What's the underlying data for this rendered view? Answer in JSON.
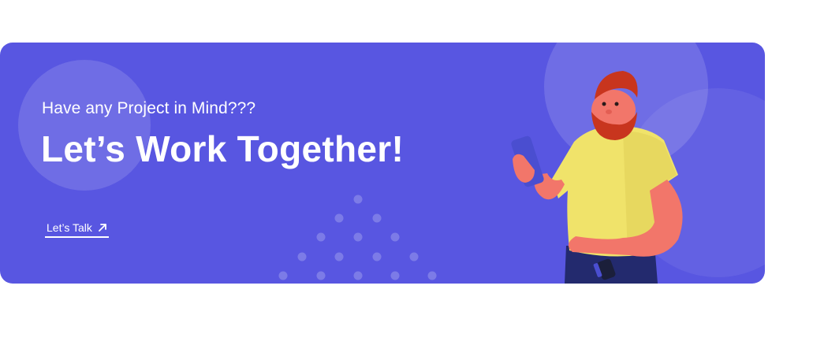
{
  "banner": {
    "subtitle": "Have any Project in Mind???",
    "title": "Let’s Work Together!",
    "cta_label": "Let’s Talk",
    "cta_icon": "arrow-up-right-icon",
    "background_color": "#5856e1",
    "illustration": "person-with-phone-illustration"
  }
}
